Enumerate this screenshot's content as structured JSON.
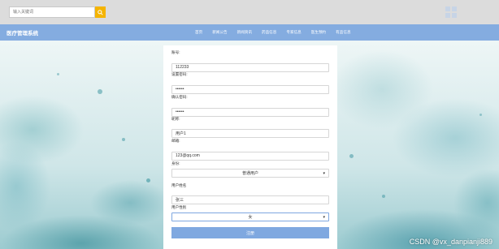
{
  "search": {
    "placeholder": "输入关键词"
  },
  "brand": "医疗管理系统",
  "nav": [
    "首页",
    "新闻公告",
    "新闻资讯",
    "药品信息",
    "专家信息",
    "医生预约",
    "有品信息"
  ],
  "form": {
    "fields": [
      {
        "label": "账号:",
        "value": "112233",
        "type": "text"
      },
      {
        "label": "设置密码:",
        "value": "••••••",
        "type": "password"
      },
      {
        "label": "确认密码:",
        "value": "••••••",
        "type": "password"
      },
      {
        "label": "昵称:",
        "value": "用户1",
        "type": "text"
      },
      {
        "label": "邮箱:",
        "value": "123@qq.com",
        "type": "text"
      }
    ],
    "identity": {
      "label": "身份:",
      "value": "普通用户"
    },
    "realname": {
      "label": "用户姓名",
      "value": "张三"
    },
    "gender": {
      "label": "用户性别",
      "value": "女"
    },
    "submit": "注册"
  },
  "watermark": "CSDN @vx_danpianji889",
  "colors": {
    "navbar": "#84ace0",
    "search_button": "#f5b400",
    "submit": "#7fa8e0"
  }
}
